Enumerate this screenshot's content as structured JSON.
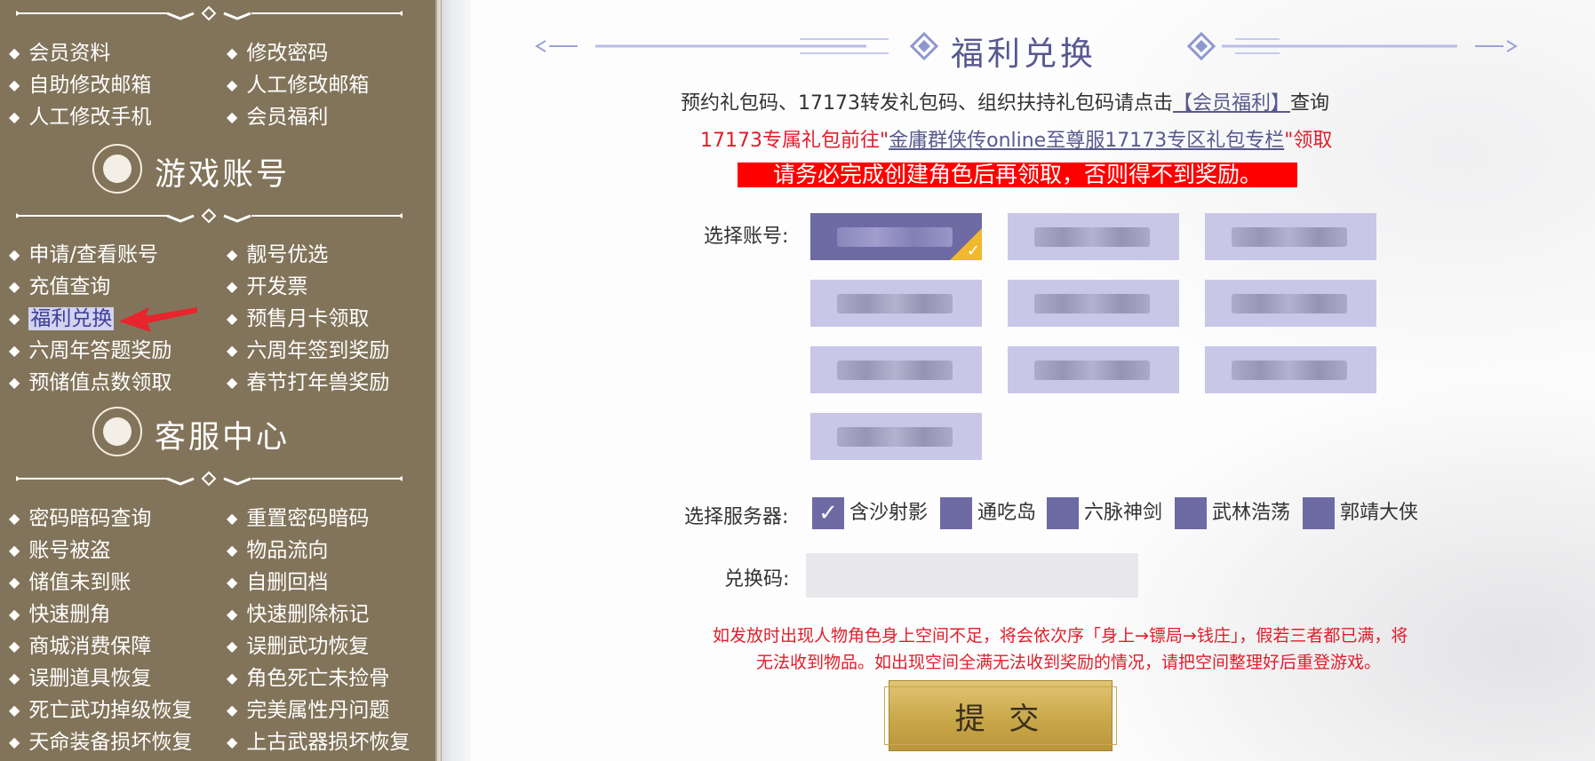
{
  "sidebar": {
    "menu_top": [
      {
        "label": "会员资料"
      },
      {
        "label": "修改密码"
      },
      {
        "label": "自助修改邮箱"
      },
      {
        "label": "人工修改邮箱"
      },
      {
        "label": "人工修改手机"
      },
      {
        "label": "会员福利"
      }
    ],
    "game_account": {
      "title": "游戏账号",
      "items": [
        {
          "label": "申请/查看账号"
        },
        {
          "label": "靓号优选"
        },
        {
          "label": "充值查询"
        },
        {
          "label": "开发票"
        },
        {
          "label": "福利兑换",
          "active": true
        },
        {
          "label": "预售月卡领取"
        },
        {
          "label": "六周年答题奖励"
        },
        {
          "label": "六周年签到奖励"
        },
        {
          "label": "预储值点数领取"
        },
        {
          "label": "春节打年兽奖励"
        }
      ]
    },
    "customer_service": {
      "title": "客服中心",
      "items": [
        {
          "label": "密码暗码查询"
        },
        {
          "label": "重置密码暗码"
        },
        {
          "label": "账号被盗"
        },
        {
          "label": "物品流向"
        },
        {
          "label": "储值未到账"
        },
        {
          "label": "自删回档"
        },
        {
          "label": "快速删角"
        },
        {
          "label": "快速删除标记"
        },
        {
          "label": "商城消费保障"
        },
        {
          "label": "误删武功恢复"
        },
        {
          "label": "误删道具恢复"
        },
        {
          "label": "角色死亡未捡骨"
        },
        {
          "label": "死亡武功掉级恢复"
        },
        {
          "label": "完美属性丹问题"
        },
        {
          "label": "天命装备损坏恢复"
        },
        {
          "label": "上古武器损坏恢复"
        }
      ]
    },
    "bullet": "◆",
    "colors": {
      "bg": "#82745a",
      "active_bg": "#d2d3ef",
      "arrow": "#e8242c"
    }
  },
  "main": {
    "title": "福利兑换",
    "notice_1": {
      "prefix": "预约礼包码、17173转发礼包码、组织扶持礼包码请点击",
      "link": "【会员福利】",
      "suffix": "查询"
    },
    "notice_2": {
      "prefix": "17173专属礼包前往\"",
      "link": "金庸群侠传online至尊服17173专区礼包专栏",
      "suffix": "\"领取"
    },
    "warning": "请务必完成创建角色后再领取，否则得不到奖励。",
    "account_label": "选择账号:",
    "accounts": [
      {
        "selected": true
      },
      {
        "selected": false
      },
      {
        "selected": false
      },
      {
        "selected": false
      },
      {
        "selected": false
      },
      {
        "selected": false
      },
      {
        "selected": false
      },
      {
        "selected": false
      },
      {
        "selected": false
      },
      {
        "selected": false
      }
    ],
    "check_glyph": "✓",
    "server_label": "选择服务器:",
    "servers": [
      {
        "name": "含沙射影",
        "checked": true
      },
      {
        "name": "通吃岛",
        "checked": false
      },
      {
        "name": "六脉神剑",
        "checked": false
      },
      {
        "name": "武林浩荡",
        "checked": false
      },
      {
        "name": "郭靖大侠",
        "checked": false
      }
    ],
    "code_label": "兑换码:",
    "code_value": "",
    "hint_line_1": "如发放时出现人物角色身上空间不足，将会依次序「身上→镖局→钱庄」，假若三者都已满，将",
    "hint_line_2": "无法收到物品。如出现空间全满无法收到奖励的情况，请把空间整理好后重登游戏。",
    "submit_label": "提 交",
    "colors": {
      "accent": "#6d6aa4",
      "tile": "#c8c7e8",
      "warning_bg": "#ff0000",
      "red_text": "#e11d2a",
      "gold": "#c9a84a"
    }
  }
}
